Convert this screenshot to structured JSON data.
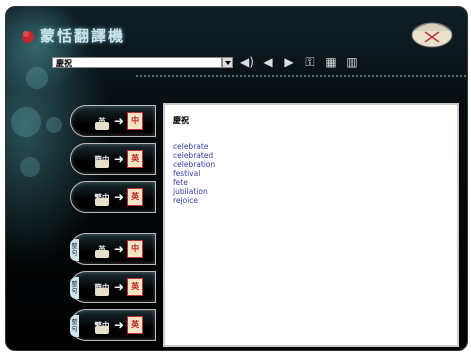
{
  "app": {
    "title": "蒙恬翻譯機"
  },
  "search": {
    "value": "慶祝"
  },
  "toolbar": {
    "icons": [
      "speaker-icon",
      "back-arrow-icon",
      "forward-arrow-icon",
      "key-icon",
      "delete-icon",
      "copy-icon"
    ]
  },
  "results": {
    "heading": "慶祝",
    "items": [
      "celebrate",
      "celebrated",
      "celebration",
      "festival",
      "fete",
      "jubilation",
      "rejoice"
    ]
  },
  "mode_buttons": [
    {
      "source": "英",
      "target": "中"
    },
    {
      "source": "簡中",
      "target": "英"
    },
    {
      "source": "繁中",
      "target": "英"
    },
    {
      "tag": "整句",
      "source": "英",
      "target": "中"
    },
    {
      "tag": "整句",
      "source": "簡中",
      "target": "英"
    },
    {
      "tag": "整句",
      "source": "繁中",
      "target": "英"
    }
  ],
  "colors": {
    "background": "#000000",
    "result_link": "#3a3aa8",
    "accent_red": "#c0282d"
  }
}
